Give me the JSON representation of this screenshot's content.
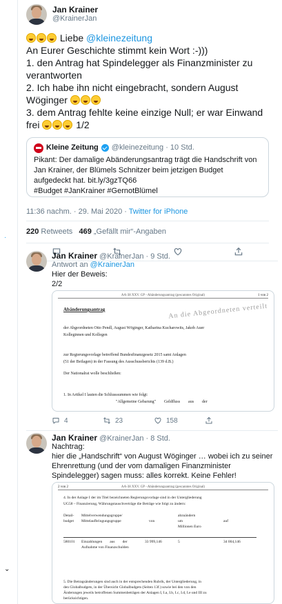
{
  "main_tweet": {
    "author": "Jan Krainer",
    "handle": "@KrainerJan",
    "line1_mention": "@kleinezeitung",
    "line1_prefix": "Liebe",
    "lines": [
      "An Eurer Geschichte stimmt kein Wort :-)))",
      "1. den Antrag hat Spindelegger als Finanzminister zu verantworten",
      "2. Ich habe ihn nicht eingebracht, sondern August Wöginger",
      "3. dem Antrag fehlte keine einzige Null; er war Einwand frei",
      "1/2"
    ],
    "timestamp": "11:36 nachm. · 29. Mai 2020 · ",
    "source": "Twitter for iPhone",
    "retweets_count": "220",
    "retweets_label": "Retweets",
    "likes_count": "469",
    "likes_label": "„Gefällt mir“-Angaben"
  },
  "quote": {
    "name": "Kleine Zeitung",
    "handle": "@kleinezeitung · 10 Std.",
    "text": "Pikant: Der damalige Abänderungsantrag trägt die Handschrift von Jan Krainer, der Blümels Schnitzer beim jetzigen Budget aufgedeckt hat.",
    "link": "bit.ly/3gzTQ66",
    "hashtags": "#Budget #JanKrainer #GernotBlümel"
  },
  "reply1": {
    "author": "Jan Krainer",
    "meta": "@KrainerJan · 9 Std.",
    "reply_to_label": "Antwort an",
    "reply_to_handle": "@KrainerJan",
    "text_line1": "Hier der Beweis:",
    "text_line2": "2/2",
    "retweets": "23",
    "likes": "158",
    "doc": {
      "header": "AA-38 XXV. GP - Abänderungsantrag (gescanntes Original)",
      "page": "1 von 2",
      "title": "Abänderungsantrag",
      "stamp": "An die Abgeordneten verteilt",
      "p1": "der Abgeordneten Otto Pendl, August Wöginger, Katharina Kucharowits, Jakob Auer",
      "p1b": "Kolleginnen und Kollegen",
      "p2": "zur Regierungsvorlage betreffend Bundesfinanzgesetz 2015 samt Anlagen",
      "p2b": "(51 der Beilagen) in der Fassung des Ausschussberichts (139 d.B.)",
      "p3": "Der Nationalrat wolle beschließen:",
      "p4": "1. In Artikel I lauten die Schlusssummen wie folgt:",
      "p5": "\"Allgemeine Gebarung\"        Geldfluss        aus        der"
    }
  },
  "reply2": {
    "author": "Jan Krainer",
    "meta": "@KrainerJan · 8 Std.",
    "text_line1": "Nachtrag:",
    "text_line2": "hier die „Handschrift“ von August Wöginger … wobei ich zu seiner Ehrenrettung (und der vom damaligen Finanzminister Spindelegger) sagen muss: alles korrekt. Keine Fehler!",
    "doc": {
      "page": "2 von 2",
      "header": "AA-38 XXV. GP - Abänderungsantrag (gescanntes Original)",
      "p1": "4. In der Anlage I der im Titel bezeichneten Regierungsvorlage sind in der Untergliederung",
      "p1b": "UG58 – Finanzierung, Währungstauschverträge die Beträge wie folgt zu ändern:",
      "col1": "Detail-",
      "col1b": "budget",
      "col2": "Mittelverwendungsgruppe/",
      "col2b": "Mittelaufbringungsgruppe",
      "col3": "von",
      "col4": "abzuändern",
      "col4b": "um",
      "col4c": "Millionen Euro",
      "col5": "auf",
      "row_id": "580101",
      "row_desc": "Einzahlungen        aus        der",
      "row_desc2": "Aufnahme von Finanzschulden",
      "row_von": "33 999,146",
      "row_um": "5",
      "row_auf": "34 004,146",
      "p2": "5. Die Betragsänderungen sind auch in der entsprechenden Rubrik, der Untergliederung, in",
      "p2b": "den Globalbudgets, in der Übersicht Globalbudgets (Seiten 13f.) sowie bei den von den",
      "p2c": "Änderungen jeweils betroffenen Summenbeträgen der Anlagen I, I.a, I.b, I.c, I.d, I.e und III zu",
      "p2d": "berücksichtigen."
    }
  },
  "colors": {
    "accent": "#1da1f2",
    "text": "#14171a",
    "muted": "#657786",
    "border": "#e6ecf0"
  }
}
